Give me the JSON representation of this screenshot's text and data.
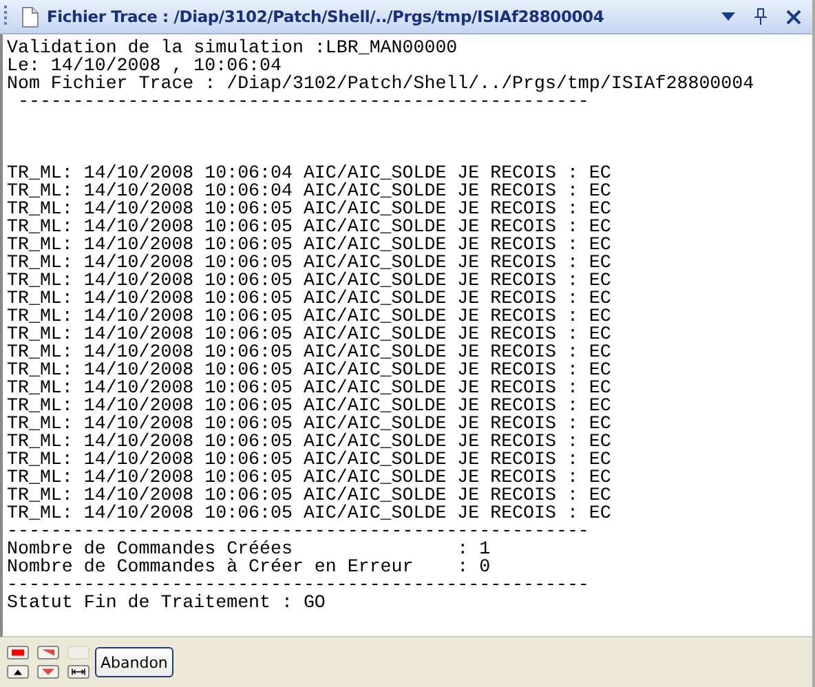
{
  "window": {
    "title": "Fichier Trace : /Diap/3102/Patch/Shell/../Prgs/tmp/ISIAf28800004"
  },
  "header_lines": [
    "Validation de la simulation :LBR_MAN00000",
    "Le: 14/10/2008 , 10:06:04",
    "Nom Fichier Trace : /Diap/3102/Patch/Shell/../Prgs/tmp/ISIAf28800004",
    " ----------------------------------------------------"
  ],
  "trace_lines": [
    "TR_ML: 14/10/2008 10:06:04 AIC/AIC_SOLDE JE RECOIS : EC",
    "TR_ML: 14/10/2008 10:06:04 AIC/AIC_SOLDE JE RECOIS : EC",
    "TR_ML: 14/10/2008 10:06:05 AIC/AIC_SOLDE JE RECOIS : EC",
    "TR_ML: 14/10/2008 10:06:05 AIC/AIC_SOLDE JE RECOIS : EC",
    "TR_ML: 14/10/2008 10:06:05 AIC/AIC_SOLDE JE RECOIS : EC",
    "TR_ML: 14/10/2008 10:06:05 AIC/AIC_SOLDE JE RECOIS : EC",
    "TR_ML: 14/10/2008 10:06:05 AIC/AIC_SOLDE JE RECOIS : EC",
    "TR_ML: 14/10/2008 10:06:05 AIC/AIC_SOLDE JE RECOIS : EC",
    "TR_ML: 14/10/2008 10:06:05 AIC/AIC_SOLDE JE RECOIS : EC",
    "TR_ML: 14/10/2008 10:06:05 AIC/AIC_SOLDE JE RECOIS : EC",
    "TR_ML: 14/10/2008 10:06:05 AIC/AIC_SOLDE JE RECOIS : EC",
    "TR_ML: 14/10/2008 10:06:05 AIC/AIC_SOLDE JE RECOIS : EC",
    "TR_ML: 14/10/2008 10:06:05 AIC/AIC_SOLDE JE RECOIS : EC",
    "TR_ML: 14/10/2008 10:06:05 AIC/AIC_SOLDE JE RECOIS : EC",
    "TR_ML: 14/10/2008 10:06:05 AIC/AIC_SOLDE JE RECOIS : EC",
    "TR_ML: 14/10/2008 10:06:05 AIC/AIC_SOLDE JE RECOIS : EC",
    "TR_ML: 14/10/2008 10:06:05 AIC/AIC_SOLDE JE RECOIS : EC",
    "TR_ML: 14/10/2008 10:06:05 AIC/AIC_SOLDE JE RECOIS : EC",
    "TR_ML: 14/10/2008 10:06:05 AIC/AIC_SOLDE JE RECOIS : EC",
    "TR_ML: 14/10/2008 10:06:05 AIC/AIC_SOLDE JE RECOIS : EC"
  ],
  "summary_lines": [
    "-----------------------------------------------------",
    "Nombre de Commandes Créées               : 1",
    "Nombre de Commandes à Créer en Erreur    : 0",
    "-----------------------------------------------------",
    "Statut Fin de Traitement : GO"
  ],
  "buttons": [
    "Abandon"
  ]
}
